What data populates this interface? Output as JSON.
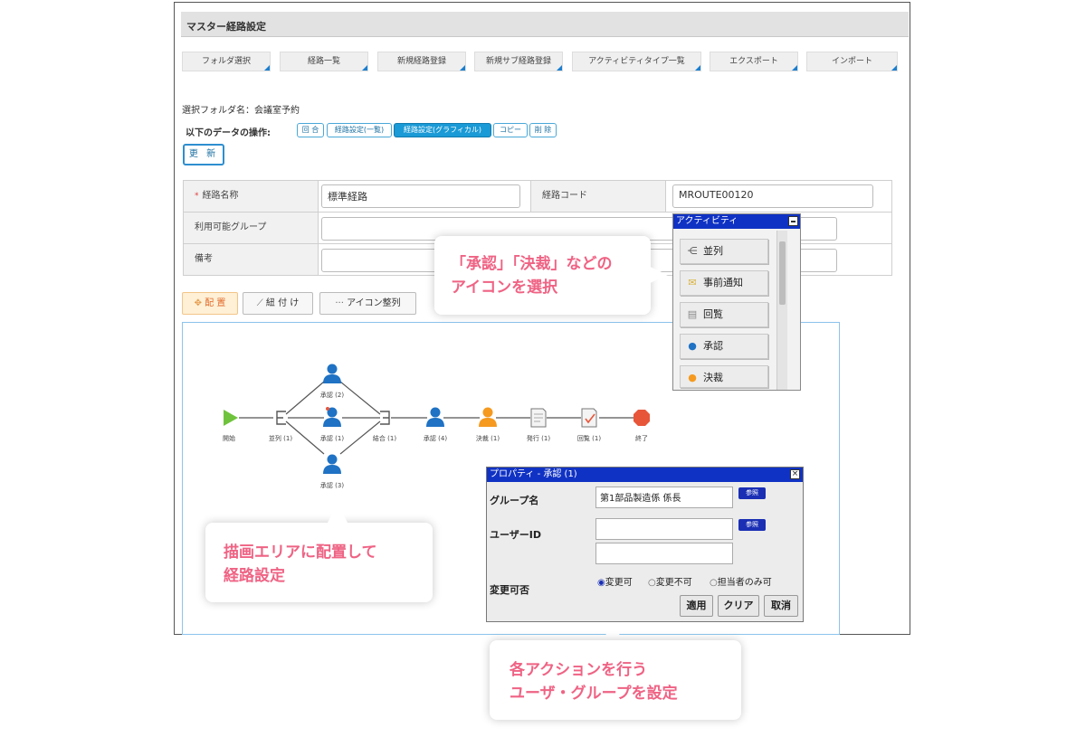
{
  "window": {
    "title": "マスター経路設定"
  },
  "tabs": [
    {
      "label": "フォルダ選択"
    },
    {
      "label": "経路一覧"
    },
    {
      "label": "新規経路登録"
    },
    {
      "label": "新規サブ経路登録"
    },
    {
      "label": "アクティビティタイプ一覧"
    },
    {
      "label": "エクスポート"
    },
    {
      "label": "インポート"
    }
  ],
  "folder": {
    "label": "選択フォルダ名：会議室予約"
  },
  "operations": {
    "label": "以下のデータの操作:",
    "buttons": [
      "回 合",
      "経路設定(一覧)",
      "経路設定(グラフィカル)",
      "コピー",
      "削 除"
    ],
    "active_index": 2
  },
  "update_button": "更 新",
  "form": {
    "route_name_label": "経路名称",
    "required_mark": "*",
    "route_name_value": "標準経路",
    "route_code_label": "経路コード",
    "route_code_value": "MROUTE00120",
    "group_label": "利用可能グループ",
    "note_label": "備考"
  },
  "toolbar": {
    "place": "配 置",
    "connect": "紐 付 け",
    "arrange": "アイコン整列"
  },
  "palette": {
    "title": "アクティビティ",
    "items": [
      "並列",
      "事前通知",
      "回覧",
      "承認",
      "決裁"
    ]
  },
  "flow": {
    "nodes": [
      "開始",
      "並列 (1)",
      "承認 (2)",
      "承認 (1)",
      "承認 (3)",
      "結合 (1)",
      "承認 (4)",
      "決裁 (1)",
      "発行 (1)",
      "回覧 (1)",
      "終了"
    ]
  },
  "dialog": {
    "title": "プロパティ - 承認 (1)",
    "group_label": "グループ名",
    "group_value": "第1部品製造係 係長",
    "ref_label": "参照",
    "user_label": "ユーザーID",
    "change_label": "変更可否",
    "options": [
      "変更可",
      "変更不可",
      "担当者のみ可"
    ],
    "selected_option": 0,
    "buttons": [
      "適用",
      "クリア",
      "取消"
    ]
  },
  "callouts": {
    "select_icon": [
      "「承認」「決裁」などの",
      "アイコンを選択"
    ],
    "draw_area": [
      "描画エリアに配置して",
      "経路設定"
    ],
    "actions": [
      "各アクションを行う",
      "ユーザ・グループを設定"
    ]
  },
  "colors": {
    "accent": "#1a9ad6",
    "dialog_header": "#1032c4",
    "callout_text": "#ef6384",
    "approver_blue": "#1f72c4",
    "approver_orange": "#f59a1f",
    "start_green": "#6fc33c",
    "end_red": "#e8563a"
  }
}
